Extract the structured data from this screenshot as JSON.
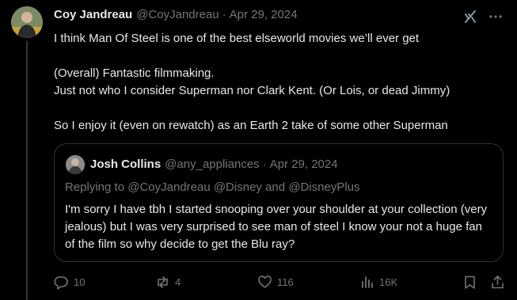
{
  "post": {
    "author_name": "Coy Jandreau",
    "handle": "@CoyJandreau",
    "sep": "·",
    "date": "Apr 29, 2024",
    "lines": [
      "I think Man Of Steel is one of the best elseworld movies we’ll ever get",
      "",
      "(Overall) Fantastic filmmaking.",
      "Just not who I consider Superman nor Clark Kent. (Or Lois, or dead Jimmy)",
      "",
      "So I enjoy it (even on rewatch) as an Earth 2 take of some other Superman"
    ]
  },
  "quote": {
    "author_name": "Josh Collins",
    "handle": "@any_appliances",
    "sep": "·",
    "date": "Apr 29, 2024",
    "replying_to": "Replying to @CoyJandreau @Disney and @DisneyPlus",
    "text": "I'm sorry I have tbh I started snooping over your shoulder at your collection (very jealous) but I was very surprised to see man of steel I know your not a huge fan of the film so why decide to get the Blu ray?"
  },
  "actions": {
    "replies": "10",
    "reposts": "4",
    "likes": "116",
    "views": "16K"
  },
  "icons": [
    "grok-icon",
    "more-icon",
    "reply-icon",
    "repost-icon",
    "like-icon",
    "views-icon",
    "bookmark-icon",
    "share-icon"
  ],
  "colors": {
    "background": "#000000",
    "text": "#e7e9ea",
    "muted": "#71767b",
    "border": "#2f3336"
  }
}
